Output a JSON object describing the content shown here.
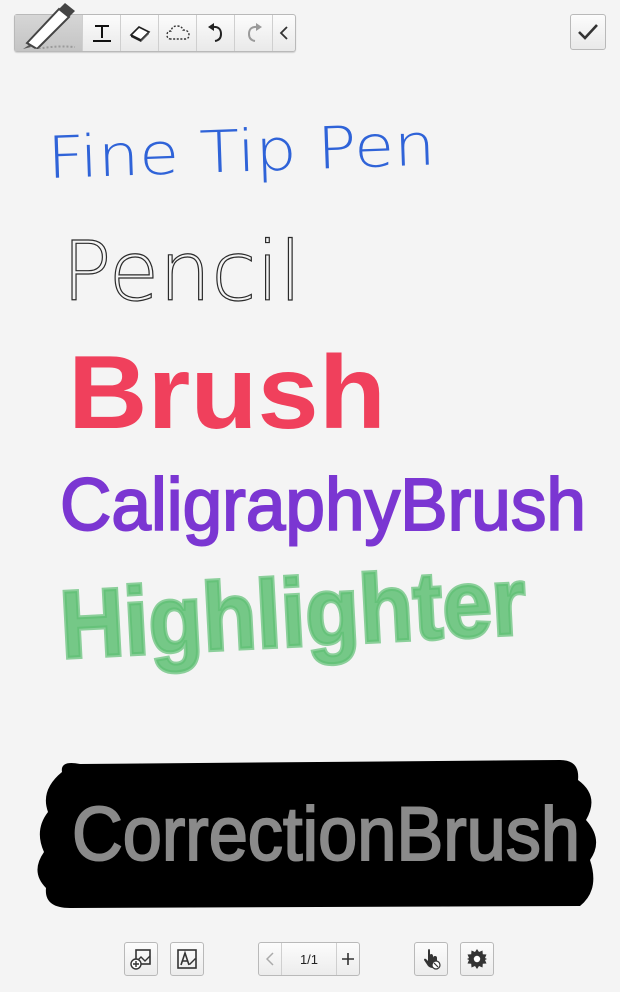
{
  "toolbar": {
    "tools": [
      "pen-tool",
      "text-tool",
      "eraser-tool",
      "lasso-selection-tool",
      "undo",
      "redo",
      "collapse"
    ]
  },
  "strokes": [
    {
      "text": "Fine Tip Pen",
      "color": "#2f63d8"
    },
    {
      "text": "Pencil",
      "color": "#2b2b2b"
    },
    {
      "text": "Brush",
      "color": "#f0405c"
    },
    {
      "text": "CaligraphyBrush",
      "color": "#7b36d2"
    },
    {
      "text": "Highlighter",
      "color": "#5ebf73"
    },
    {
      "text": "CorrectionBrush",
      "color": "#8a8a8a",
      "background": "#000000"
    }
  ],
  "bottom_bar": {
    "page_indicator": "1/1"
  }
}
